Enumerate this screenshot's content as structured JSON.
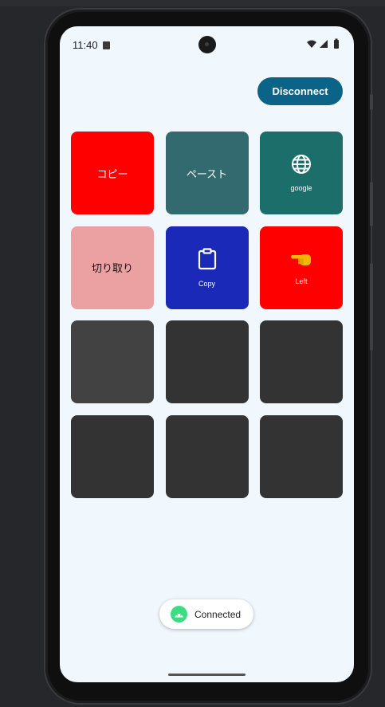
{
  "status_bar": {
    "time": "11:40"
  },
  "header": {
    "disconnect_label": "Disconnect"
  },
  "grid": {
    "tiles": [
      {
        "label": "コピー",
        "color": "#ff0000"
      },
      {
        "label": "ペースト",
        "color": "#326a70"
      },
      {
        "label": "google",
        "icon": "globe-icon",
        "color": "#1b6e6a"
      },
      {
        "label": "切り取り",
        "color": "#eba1a2"
      },
      {
        "label": "Copy",
        "icon": "clipboard-icon",
        "color": "#1a29b8"
      },
      {
        "label": "Left",
        "icon": "pointing-left-hand-icon",
        "color": "#ff0000"
      },
      {
        "label": "",
        "color": "#424242"
      },
      {
        "label": "",
        "color": "#333333"
      },
      {
        "label": "",
        "color": "#333333"
      },
      {
        "label": "",
        "color": "#333333"
      },
      {
        "label": "",
        "color": "#333333"
      },
      {
        "label": "",
        "color": "#333333"
      }
    ]
  },
  "toast": {
    "label": "Connected",
    "icon": "android-icon",
    "badge_color": "#3ddc84"
  },
  "colors": {
    "screen_bg": "#f0f7fd",
    "accent": "#0b6388"
  }
}
